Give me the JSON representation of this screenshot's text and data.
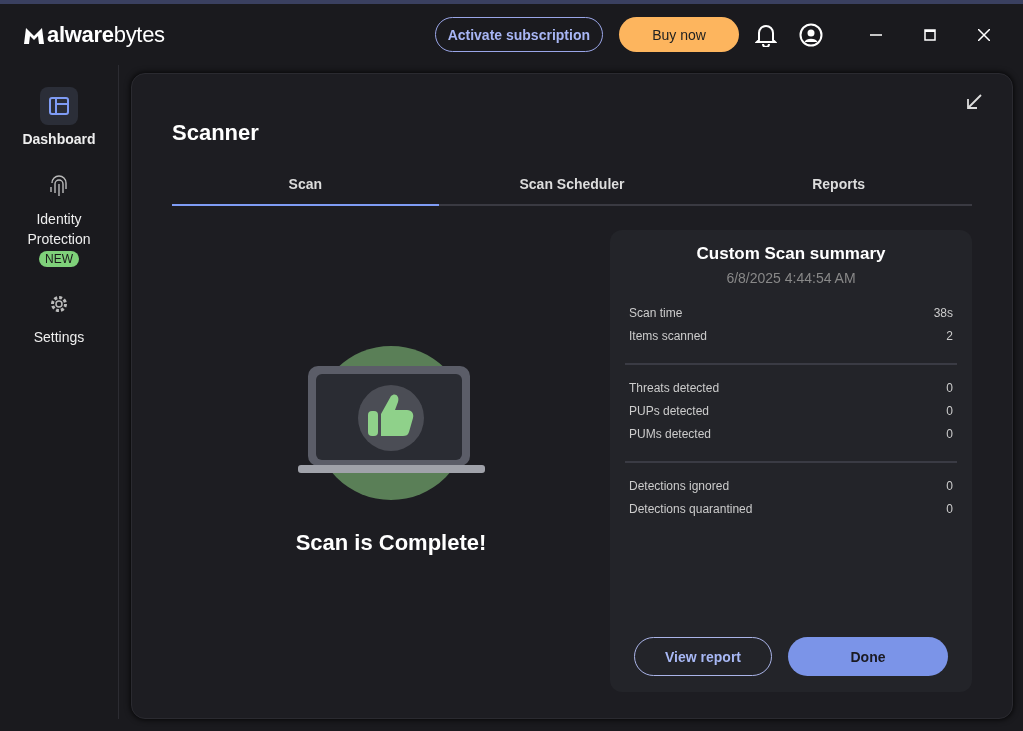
{
  "header": {
    "logo_text": "**alware**bytes",
    "activate_button": "Activate subscription",
    "buy_button": "Buy now"
  },
  "sidebar": {
    "items": [
      {
        "kind": "dashboard",
        "label": "Dashboard",
        "selected": true
      },
      {
        "kind": "identity",
        "label": "Identity Protection",
        "badge": "NEW",
        "selected": false
      },
      {
        "kind": "settings",
        "label": "Settings",
        "selected": false
      }
    ]
  },
  "scanner": {
    "title": "Scanner",
    "tabs": [
      {
        "label": "Scan",
        "selected": true
      },
      {
        "label": "Scan Scheduler",
        "selected": false
      },
      {
        "label": "Reports",
        "selected": false
      }
    ],
    "status": "Scan is Complete!",
    "summary": {
      "title": "Custom Scan summary",
      "date": "6/8/2025 4:44:54 AM",
      "groups": [
        [
          {
            "label": "Scan time",
            "value": "38s"
          },
          {
            "label": "Items scanned",
            "value": "2"
          }
        ],
        [
          {
            "label": "Threats detected",
            "value": "0"
          },
          {
            "label": "PUPs detected",
            "value": "0"
          },
          {
            "label": "PUMs detected",
            "value": "0"
          }
        ],
        [
          {
            "label": "Detections ignored",
            "value": "0"
          },
          {
            "label": "Detections quarantined",
            "value": "0"
          }
        ]
      ],
      "view_button": "View report",
      "done_button": "Done"
    }
  }
}
